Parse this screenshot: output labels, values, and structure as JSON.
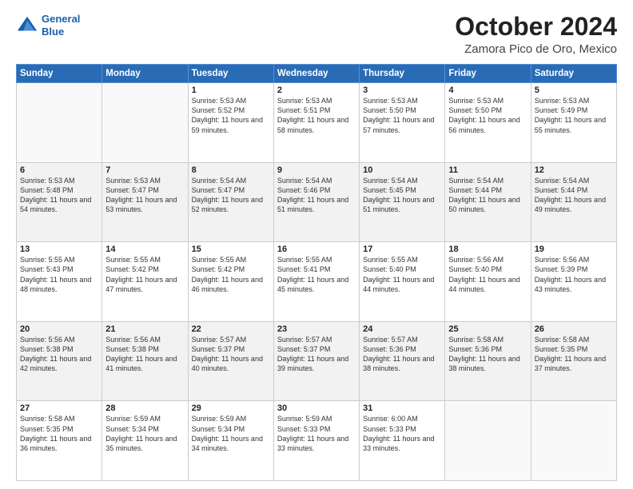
{
  "logo": {
    "line1": "General",
    "line2": "Blue"
  },
  "title": "October 2024",
  "subtitle": "Zamora Pico de Oro, Mexico",
  "days_of_week": [
    "Sunday",
    "Monday",
    "Tuesday",
    "Wednesday",
    "Thursday",
    "Friday",
    "Saturday"
  ],
  "weeks": [
    [
      {
        "day": "",
        "sunrise": "",
        "sunset": "",
        "daylight": ""
      },
      {
        "day": "",
        "sunrise": "",
        "sunset": "",
        "daylight": ""
      },
      {
        "day": "1",
        "sunrise": "Sunrise: 5:53 AM",
        "sunset": "Sunset: 5:52 PM",
        "daylight": "Daylight: 11 hours and 59 minutes."
      },
      {
        "day": "2",
        "sunrise": "Sunrise: 5:53 AM",
        "sunset": "Sunset: 5:51 PM",
        "daylight": "Daylight: 11 hours and 58 minutes."
      },
      {
        "day": "3",
        "sunrise": "Sunrise: 5:53 AM",
        "sunset": "Sunset: 5:50 PM",
        "daylight": "Daylight: 11 hours and 57 minutes."
      },
      {
        "day": "4",
        "sunrise": "Sunrise: 5:53 AM",
        "sunset": "Sunset: 5:50 PM",
        "daylight": "Daylight: 11 hours and 56 minutes."
      },
      {
        "day": "5",
        "sunrise": "Sunrise: 5:53 AM",
        "sunset": "Sunset: 5:49 PM",
        "daylight": "Daylight: 11 hours and 55 minutes."
      }
    ],
    [
      {
        "day": "6",
        "sunrise": "Sunrise: 5:53 AM",
        "sunset": "Sunset: 5:48 PM",
        "daylight": "Daylight: 11 hours and 54 minutes."
      },
      {
        "day": "7",
        "sunrise": "Sunrise: 5:53 AM",
        "sunset": "Sunset: 5:47 PM",
        "daylight": "Daylight: 11 hours and 53 minutes."
      },
      {
        "day": "8",
        "sunrise": "Sunrise: 5:54 AM",
        "sunset": "Sunset: 5:47 PM",
        "daylight": "Daylight: 11 hours and 52 minutes."
      },
      {
        "day": "9",
        "sunrise": "Sunrise: 5:54 AM",
        "sunset": "Sunset: 5:46 PM",
        "daylight": "Daylight: 11 hours and 51 minutes."
      },
      {
        "day": "10",
        "sunrise": "Sunrise: 5:54 AM",
        "sunset": "Sunset: 5:45 PM",
        "daylight": "Daylight: 11 hours and 51 minutes."
      },
      {
        "day": "11",
        "sunrise": "Sunrise: 5:54 AM",
        "sunset": "Sunset: 5:44 PM",
        "daylight": "Daylight: 11 hours and 50 minutes."
      },
      {
        "day": "12",
        "sunrise": "Sunrise: 5:54 AM",
        "sunset": "Sunset: 5:44 PM",
        "daylight": "Daylight: 11 hours and 49 minutes."
      }
    ],
    [
      {
        "day": "13",
        "sunrise": "Sunrise: 5:55 AM",
        "sunset": "Sunset: 5:43 PM",
        "daylight": "Daylight: 11 hours and 48 minutes."
      },
      {
        "day": "14",
        "sunrise": "Sunrise: 5:55 AM",
        "sunset": "Sunset: 5:42 PM",
        "daylight": "Daylight: 11 hours and 47 minutes."
      },
      {
        "day": "15",
        "sunrise": "Sunrise: 5:55 AM",
        "sunset": "Sunset: 5:42 PM",
        "daylight": "Daylight: 11 hours and 46 minutes."
      },
      {
        "day": "16",
        "sunrise": "Sunrise: 5:55 AM",
        "sunset": "Sunset: 5:41 PM",
        "daylight": "Daylight: 11 hours and 45 minutes."
      },
      {
        "day": "17",
        "sunrise": "Sunrise: 5:55 AM",
        "sunset": "Sunset: 5:40 PM",
        "daylight": "Daylight: 11 hours and 44 minutes."
      },
      {
        "day": "18",
        "sunrise": "Sunrise: 5:56 AM",
        "sunset": "Sunset: 5:40 PM",
        "daylight": "Daylight: 11 hours and 44 minutes."
      },
      {
        "day": "19",
        "sunrise": "Sunrise: 5:56 AM",
        "sunset": "Sunset: 5:39 PM",
        "daylight": "Daylight: 11 hours and 43 minutes."
      }
    ],
    [
      {
        "day": "20",
        "sunrise": "Sunrise: 5:56 AM",
        "sunset": "Sunset: 5:38 PM",
        "daylight": "Daylight: 11 hours and 42 minutes."
      },
      {
        "day": "21",
        "sunrise": "Sunrise: 5:56 AM",
        "sunset": "Sunset: 5:38 PM",
        "daylight": "Daylight: 11 hours and 41 minutes."
      },
      {
        "day": "22",
        "sunrise": "Sunrise: 5:57 AM",
        "sunset": "Sunset: 5:37 PM",
        "daylight": "Daylight: 11 hours and 40 minutes."
      },
      {
        "day": "23",
        "sunrise": "Sunrise: 5:57 AM",
        "sunset": "Sunset: 5:37 PM",
        "daylight": "Daylight: 11 hours and 39 minutes."
      },
      {
        "day": "24",
        "sunrise": "Sunrise: 5:57 AM",
        "sunset": "Sunset: 5:36 PM",
        "daylight": "Daylight: 11 hours and 38 minutes."
      },
      {
        "day": "25",
        "sunrise": "Sunrise: 5:58 AM",
        "sunset": "Sunset: 5:36 PM",
        "daylight": "Daylight: 11 hours and 38 minutes."
      },
      {
        "day": "26",
        "sunrise": "Sunrise: 5:58 AM",
        "sunset": "Sunset: 5:35 PM",
        "daylight": "Daylight: 11 hours and 37 minutes."
      }
    ],
    [
      {
        "day": "27",
        "sunrise": "Sunrise: 5:58 AM",
        "sunset": "Sunset: 5:35 PM",
        "daylight": "Daylight: 11 hours and 36 minutes."
      },
      {
        "day": "28",
        "sunrise": "Sunrise: 5:59 AM",
        "sunset": "Sunset: 5:34 PM",
        "daylight": "Daylight: 11 hours and 35 minutes."
      },
      {
        "day": "29",
        "sunrise": "Sunrise: 5:59 AM",
        "sunset": "Sunset: 5:34 PM",
        "daylight": "Daylight: 11 hours and 34 minutes."
      },
      {
        "day": "30",
        "sunrise": "Sunrise: 5:59 AM",
        "sunset": "Sunset: 5:33 PM",
        "daylight": "Daylight: 11 hours and 33 minutes."
      },
      {
        "day": "31",
        "sunrise": "Sunrise: 6:00 AM",
        "sunset": "Sunset: 5:33 PM",
        "daylight": "Daylight: 11 hours and 33 minutes."
      },
      {
        "day": "",
        "sunrise": "",
        "sunset": "",
        "daylight": ""
      },
      {
        "day": "",
        "sunrise": "",
        "sunset": "",
        "daylight": ""
      }
    ]
  ]
}
